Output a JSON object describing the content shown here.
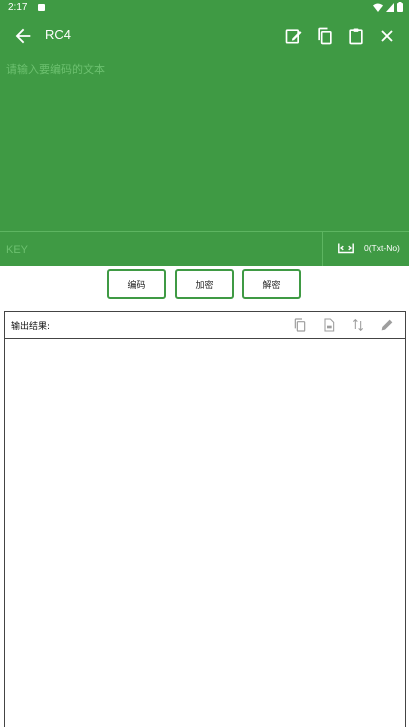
{
  "status": {
    "time": "2:17"
  },
  "app_bar": {
    "title": "RC4"
  },
  "input": {
    "placeholder": "请输入要编码的文本"
  },
  "key": {
    "placeholder": "KEY",
    "mode_label": "0(Txt-No)"
  },
  "buttons": {
    "encode": "编码",
    "encrypt": "加密",
    "decrypt": "解密"
  },
  "output": {
    "label": "输出结果:"
  },
  "colors": {
    "primary": "#3f9a44",
    "placeholder": "#6cc06f"
  },
  "icons": [
    "back-arrow-icon",
    "edit-note-icon",
    "copy-icon",
    "paste-icon",
    "close-icon",
    "code-brackets-icon",
    "copy-icon",
    "doc-icon",
    "swap-vert-icon",
    "pencil-icon"
  ]
}
